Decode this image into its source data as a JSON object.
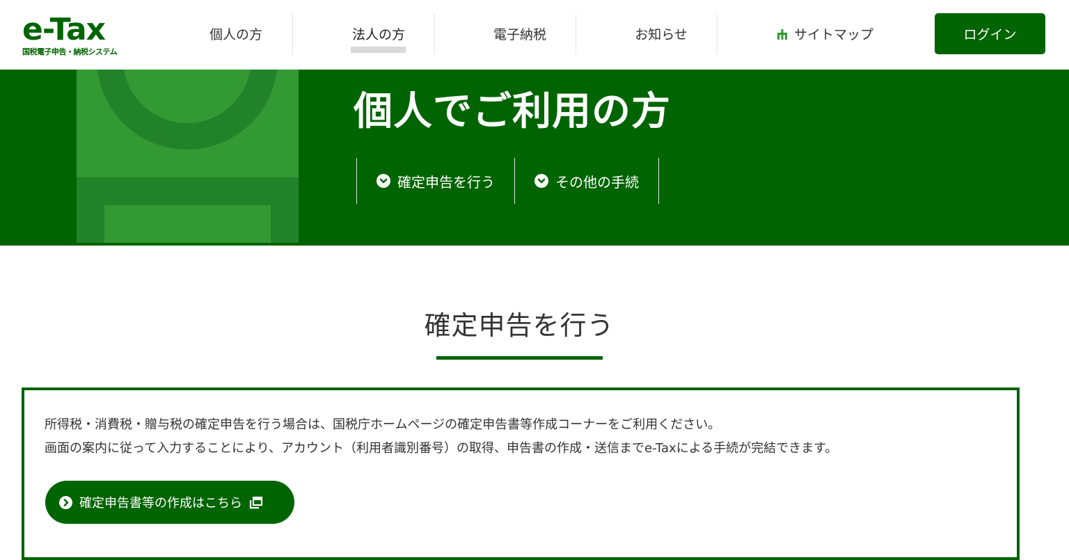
{
  "colors": {
    "brand_green": "#006400",
    "art_green": "#339933",
    "art_dark_green": "#22822a",
    "divider": "#e3e3e3"
  },
  "logo": {
    "main": "e-Tax",
    "sub": "国税電子申告・納税システム"
  },
  "nav": {
    "items": [
      "個人の方",
      "法人の方",
      "電子納税",
      "お知らせ"
    ],
    "sitemap_label": "サイトマップ",
    "sitemap_icon": "sitemap-icon",
    "active_index": 1,
    "login_label": "ログイン"
  },
  "hero": {
    "title": "個人でご利用の方",
    "links": [
      {
        "label": "確定申告を行う",
        "icon": "chevron-down-icon"
      },
      {
        "label": "その他の手続",
        "icon": "chevron-down-icon"
      }
    ]
  },
  "section": {
    "title": "確定申告を行う",
    "description": [
      "所得税・消費税・贈与税の確定申告を行う場合は、国税庁ホームページの確定申告書等作成コーナーをご利用ください。",
      "画面の案内に従って入力することにより、アカウント（利用者識別番号）の取得、申告書の作成・送信までe-Taxによる手続が完結できます。"
    ],
    "cta_label": "確定申告書等の作成はこちら",
    "cta_icons": [
      "chevron-right-icon",
      "external-window-icon"
    ]
  }
}
